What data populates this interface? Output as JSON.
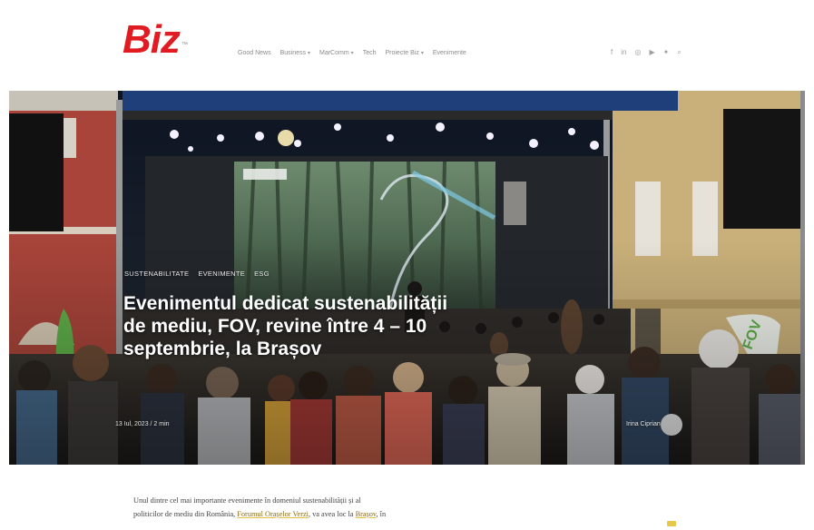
{
  "header": {
    "logo_text": "Biz",
    "logo_mark": "™",
    "logo_color": "#e11b22",
    "nav": [
      {
        "label": "Good News",
        "dropdown": false
      },
      {
        "label": "Business",
        "dropdown": true
      },
      {
        "label": "MarComm",
        "dropdown": true
      },
      {
        "label": "Tech",
        "dropdown": false
      },
      {
        "label": "Proiecte Biz",
        "dropdown": true
      },
      {
        "label": "Evenimente",
        "dropdown": false
      }
    ],
    "social_icons": [
      "facebook-icon",
      "linkedin-icon",
      "instagram-icon",
      "youtube-icon",
      "twitter-icon",
      "search-icon"
    ]
  },
  "hero": {
    "categories": [
      "SUSTENABILITATE",
      "EVENIMENTE",
      "ESG"
    ],
    "title": "Evenimentul dedicat sustenabilității de mediu, FOV, revine între 4 – 10 septembrie, la Brașov",
    "meta_left": "13 Iul, 2023 / 2 min",
    "meta_right": "Irina Ciprian",
    "image_description_icons": [
      "stage-photo"
    ]
  },
  "article": {
    "p1_a": "Unul dintre cel mai importante evenimente în domeniul sustenabilității și al",
    "p1_b": "politicilor de mediu din România, ",
    "p1_link1": "Forumul Orașelor Verzi",
    "p1_c": ", va avea loc la ",
    "p1_link2": "Brașov",
    "p1_d": ", în"
  },
  "colors": {
    "accent": "#e11b22",
    "link_underline": "#e2c144"
  }
}
